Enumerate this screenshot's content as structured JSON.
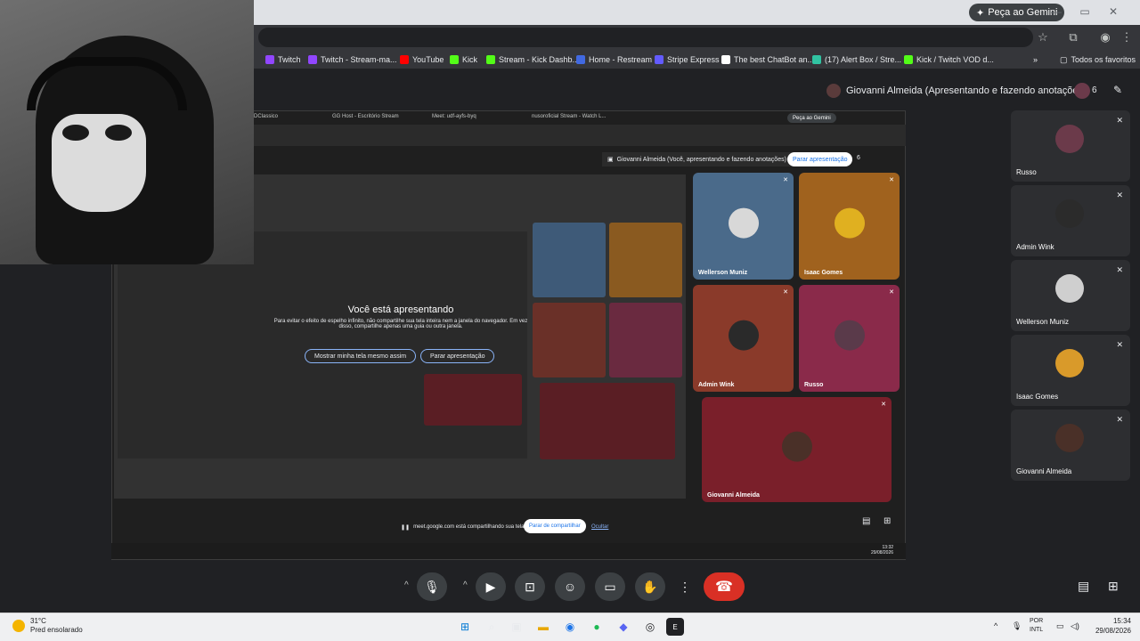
{
  "browser": {
    "gemini_button": "Peça ao Gemini",
    "bookmarks": [
      {
        "label": "Twitch",
        "color": "#9146ff"
      },
      {
        "label": "Twitch - Stream-ma...",
        "color": "#9146ff"
      },
      {
        "label": "YouTube",
        "color": "#ff0000"
      },
      {
        "label": "Kick",
        "color": "#53fc18"
      },
      {
        "label": "Stream - Kick Dashb...",
        "color": "#53fc18"
      },
      {
        "label": "Home - Restream",
        "color": "#4169e1"
      },
      {
        "label": "Stripe Express",
        "color": "#635bff"
      },
      {
        "label": "The best ChatBot an...",
        "color": "#ffffff"
      },
      {
        "label": "(17) Alert Box / Stre...",
        "color": "#31c3a2"
      },
      {
        "label": "Kick / Twitch VOD d...",
        "color": "#53fc18"
      }
    ],
    "all_favorites": "Todos os favoritos"
  },
  "meet": {
    "presenter_banner": "Giovanni Almeida (Apresentando e fazendo anotações)",
    "participant_count": "6",
    "shared_screen": {
      "tabs": [
        "DClassico",
        "GG Host - Escritório Stream",
        "Meet: udf-ayfs-byq",
        "nusoroficial Stream - Watch L..."
      ],
      "gemini_button": "Peça ao Gemini",
      "presenter_banner": "Giovanni Almeida (Você, apresentando e fazendo anotações)",
      "stop_presenting": "Parar apresentação",
      "count": "6",
      "overlay_title": "Você está apresentando",
      "overlay_desc": "Para evitar o efeito de espelho infinito, não compartilhe sua tela inteira nem a janela do navegador. Em vez disso, compartilhe apenas uma guia ou outra janela.",
      "show_anyway": "Mostrar minha tela mesmo assim",
      "stop_presenting_btn": "Parar apresentação",
      "tiles": [
        {
          "name": "Wellerson Muniz",
          "bg": "#4a6a8a",
          "avatar": "#d8d8d8"
        },
        {
          "name": "Isaac Gomes",
          "bg": "#a0621e",
          "avatar": "#e0b020"
        },
        {
          "name": "Admin Wink",
          "bg": "#8a3a2a",
          "avatar": "#3a3a3a"
        },
        {
          "name": "Russo",
          "bg": "#8a2a4a",
          "avatar": "#5a3a4a"
        },
        {
          "name": "Giovanni Almeida",
          "bg": "#7a1f2a",
          "avatar": "#4a3028"
        }
      ],
      "share_message": "meet.google.com está compartilhando sua tela.",
      "stop_sharing": "Parar de compartilhar",
      "hide": "Ocultar",
      "time": "13:32",
      "date": "29/08/2026"
    },
    "participants": [
      {
        "name": "Russo",
        "avatar": "#6b3a4a"
      },
      {
        "name": "Admin Wink",
        "avatar": "#2b2b2b"
      },
      {
        "name": "Wellerson Muniz",
        "avatar": "#cfcfcf"
      },
      {
        "name": "Isaac Gomes",
        "avatar": "#d99a2a"
      },
      {
        "name": "Giovanni Almeida",
        "avatar": "#4a3028"
      }
    ]
  },
  "taskbar": {
    "temperature": "31°C",
    "weather": "Pred ensolarado",
    "lang_top": "POR",
    "lang_bottom": "INTL",
    "time": "15:34",
    "date": "29/08/2026"
  }
}
